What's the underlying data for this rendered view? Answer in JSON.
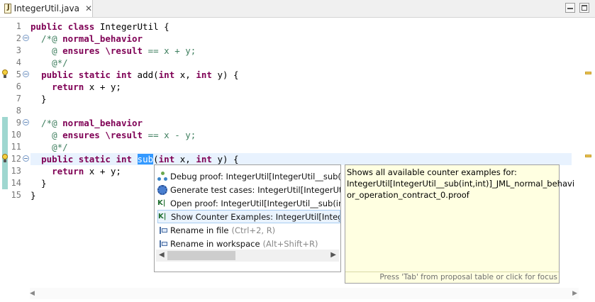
{
  "tab": {
    "title": "IntegerUtil.java",
    "close": "✕"
  },
  "gutter": [
    "1",
    "2",
    "3",
    "4",
    "5",
    "6",
    "7",
    "8",
    "9",
    "10",
    "11",
    "12",
    "13",
    "14",
    "15"
  ],
  "code": {
    "l1": [
      "public",
      " ",
      "class",
      " IntegerUtil {"
    ],
    "l2": [
      "  /*@ ",
      "normal_behavior"
    ],
    "l3": [
      "    @ ",
      "ensures",
      " ",
      "\\result",
      " == x + y;"
    ],
    "l4": [
      "    @*/"
    ],
    "l5": [
      "  ",
      "public",
      " ",
      "static",
      " ",
      "int",
      " add(",
      "int",
      " x, ",
      "int",
      " y) {"
    ],
    "l6": [
      "    ",
      "return",
      " x + y;"
    ],
    "l7": [
      "  }"
    ],
    "l9": [
      "  /*@ ",
      "normal_behavior"
    ],
    "l10": [
      "    @ ",
      "ensures",
      " ",
      "\\result",
      " == x - y;"
    ],
    "l11": [
      "    @*/"
    ],
    "l12": [
      "  ",
      "public",
      " ",
      "static",
      " ",
      "int",
      " ",
      "sub",
      "(",
      "int",
      " x, ",
      "int",
      " y) {"
    ],
    "l13": [
      "    ",
      "return",
      " x + y;"
    ],
    "l14": [
      "  }"
    ],
    "l15": [
      "}"
    ]
  },
  "proposals": [
    {
      "label": "Debug proof: IntegerUtil[IntegerUtil__sub(int,int)]_JML_normal_behavior_operation_contract_0.proof",
      "icon": "debug-icon"
    },
    {
      "label": "Generate test cases: IntegerUtil[IntegerUtil__sub(int,int)]_JML_normal_behavior_operation_contract_0.proof",
      "icon": "gear-icon"
    },
    {
      "label": "Open proof: IntegerUtil[IntegerUtil__sub(int,int)]_JML_normal_behavior_operation_contract_0.proof",
      "icon": "key-icon"
    },
    {
      "label": "Show Counter Examples: IntegerUtil[IntegerUtil__sub(int,int)]_JML_normal_behavior_operation_contract_0.proof",
      "icon": "key-icon"
    },
    {
      "label": "Rename in file",
      "shortcut": "(Ctrl+2, R)",
      "icon": "rename-icon"
    },
    {
      "label": "Rename in workspace",
      "shortcut": "(Alt+Shift+R)",
      "icon": "rename-icon"
    }
  ],
  "info": {
    "line1": "Shows all available counter examples for:",
    "line2": "IntegerUtil[IntegerUtil__sub(int,int)]_JML_normal_behavi",
    "line3": "or_operation_contract_0.proof",
    "footer": "Press 'Tab' from proposal table or click for focus"
  },
  "colors": {
    "keyword": "#7f0055",
    "comment": "#3f7f5f",
    "selection": "#3399ff",
    "current_line": "#e8f2fe"
  }
}
